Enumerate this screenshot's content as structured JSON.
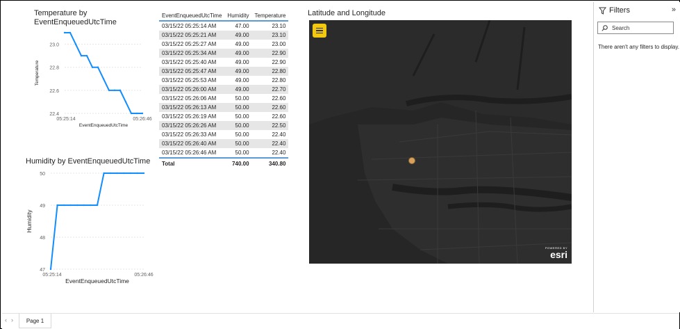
{
  "temperature_chart": {
    "title": "Temperature by EventEnqueuedUtcTime",
    "chart_data": {
      "type": "line",
      "xlabel": "EventEnqueuedUtcTime",
      "ylabel": "Temperature",
      "x_tick_labels": [
        "05:25:14",
        "05:26:46"
      ],
      "y_tick_labels": [
        "22.4",
        "22.6",
        "22.8",
        "23.0"
      ],
      "ylim": [
        22.4,
        23.1
      ],
      "x": [
        "05:25:14",
        "05:25:21",
        "05:25:27",
        "05:25:34",
        "05:25:40",
        "05:25:47",
        "05:25:53",
        "05:26:00",
        "05:26:06",
        "05:26:13",
        "05:26:19",
        "05:26:26",
        "05:26:33",
        "05:26:40",
        "05:26:46"
      ],
      "values": [
        23.1,
        23.1,
        23.0,
        22.9,
        22.9,
        22.8,
        22.8,
        22.7,
        22.6,
        22.6,
        22.6,
        22.5,
        22.4,
        22.4,
        22.4
      ],
      "color": "#118dff",
      "grid": true
    }
  },
  "humidity_chart": {
    "title": "Humidity by EventEnqueuedUtcTime",
    "chart_data": {
      "type": "line",
      "xlabel": "EventEnqueuedUtcTime",
      "ylabel": "Humidity",
      "x_tick_labels": [
        "05:25:14",
        "05:26:46"
      ],
      "y_tick_labels": [
        "47",
        "48",
        "49",
        "50"
      ],
      "ylim": [
        47,
        50
      ],
      "x": [
        "05:25:14",
        "05:25:21",
        "05:25:27",
        "05:25:34",
        "05:25:40",
        "05:25:47",
        "05:25:53",
        "05:26:00",
        "05:26:06",
        "05:26:13",
        "05:26:19",
        "05:26:26",
        "05:26:33",
        "05:26:40",
        "05:26:46"
      ],
      "values": [
        47,
        49,
        49,
        49,
        49,
        49,
        49,
        49,
        50,
        50,
        50,
        50,
        50,
        50,
        50
      ],
      "color": "#118dff",
      "grid": true
    }
  },
  "table": {
    "columns": [
      "EventEnqueuedUtcTime",
      "Humidity",
      "Temperature"
    ],
    "rows": [
      [
        "03/15/22 05:25:14 AM",
        "47.00",
        "23.10"
      ],
      [
        "03/15/22 05:25:21 AM",
        "49.00",
        "23.10"
      ],
      [
        "03/15/22 05:25:27 AM",
        "49.00",
        "23.00"
      ],
      [
        "03/15/22 05:25:34 AM",
        "49.00",
        "22.90"
      ],
      [
        "03/15/22 05:25:40 AM",
        "49.00",
        "22.90"
      ],
      [
        "03/15/22 05:25:47 AM",
        "49.00",
        "22.80"
      ],
      [
        "03/15/22 05:25:53 AM",
        "49.00",
        "22.80"
      ],
      [
        "03/15/22 05:26:00 AM",
        "49.00",
        "22.70"
      ],
      [
        "03/15/22 05:26:06 AM",
        "50.00",
        "22.60"
      ],
      [
        "03/15/22 05:26:13 AM",
        "50.00",
        "22.60"
      ],
      [
        "03/15/22 05:26:19 AM",
        "50.00",
        "22.60"
      ],
      [
        "03/15/22 05:26:26 AM",
        "50.00",
        "22.50"
      ],
      [
        "03/15/22 05:26:33 AM",
        "50.00",
        "22.40"
      ],
      [
        "03/15/22 05:26:40 AM",
        "50.00",
        "22.40"
      ],
      [
        "03/15/22 05:26:46 AM",
        "50.00",
        "22.40"
      ]
    ],
    "total": [
      "Total",
      "740.00",
      "340.80"
    ]
  },
  "map": {
    "title": "Latitude and Longitude",
    "attribution_small": "POWERED BY",
    "attribution_brand": "esri",
    "point_color": "#d9a05b",
    "icon": "hamburger-menu-icon"
  },
  "filters": {
    "title": "Filters",
    "search_placeholder": "Search",
    "empty_message": "There aren't any filters to display.",
    "icon": "funnel-icon"
  },
  "pages": {
    "tabs": [
      "Page 1"
    ]
  }
}
